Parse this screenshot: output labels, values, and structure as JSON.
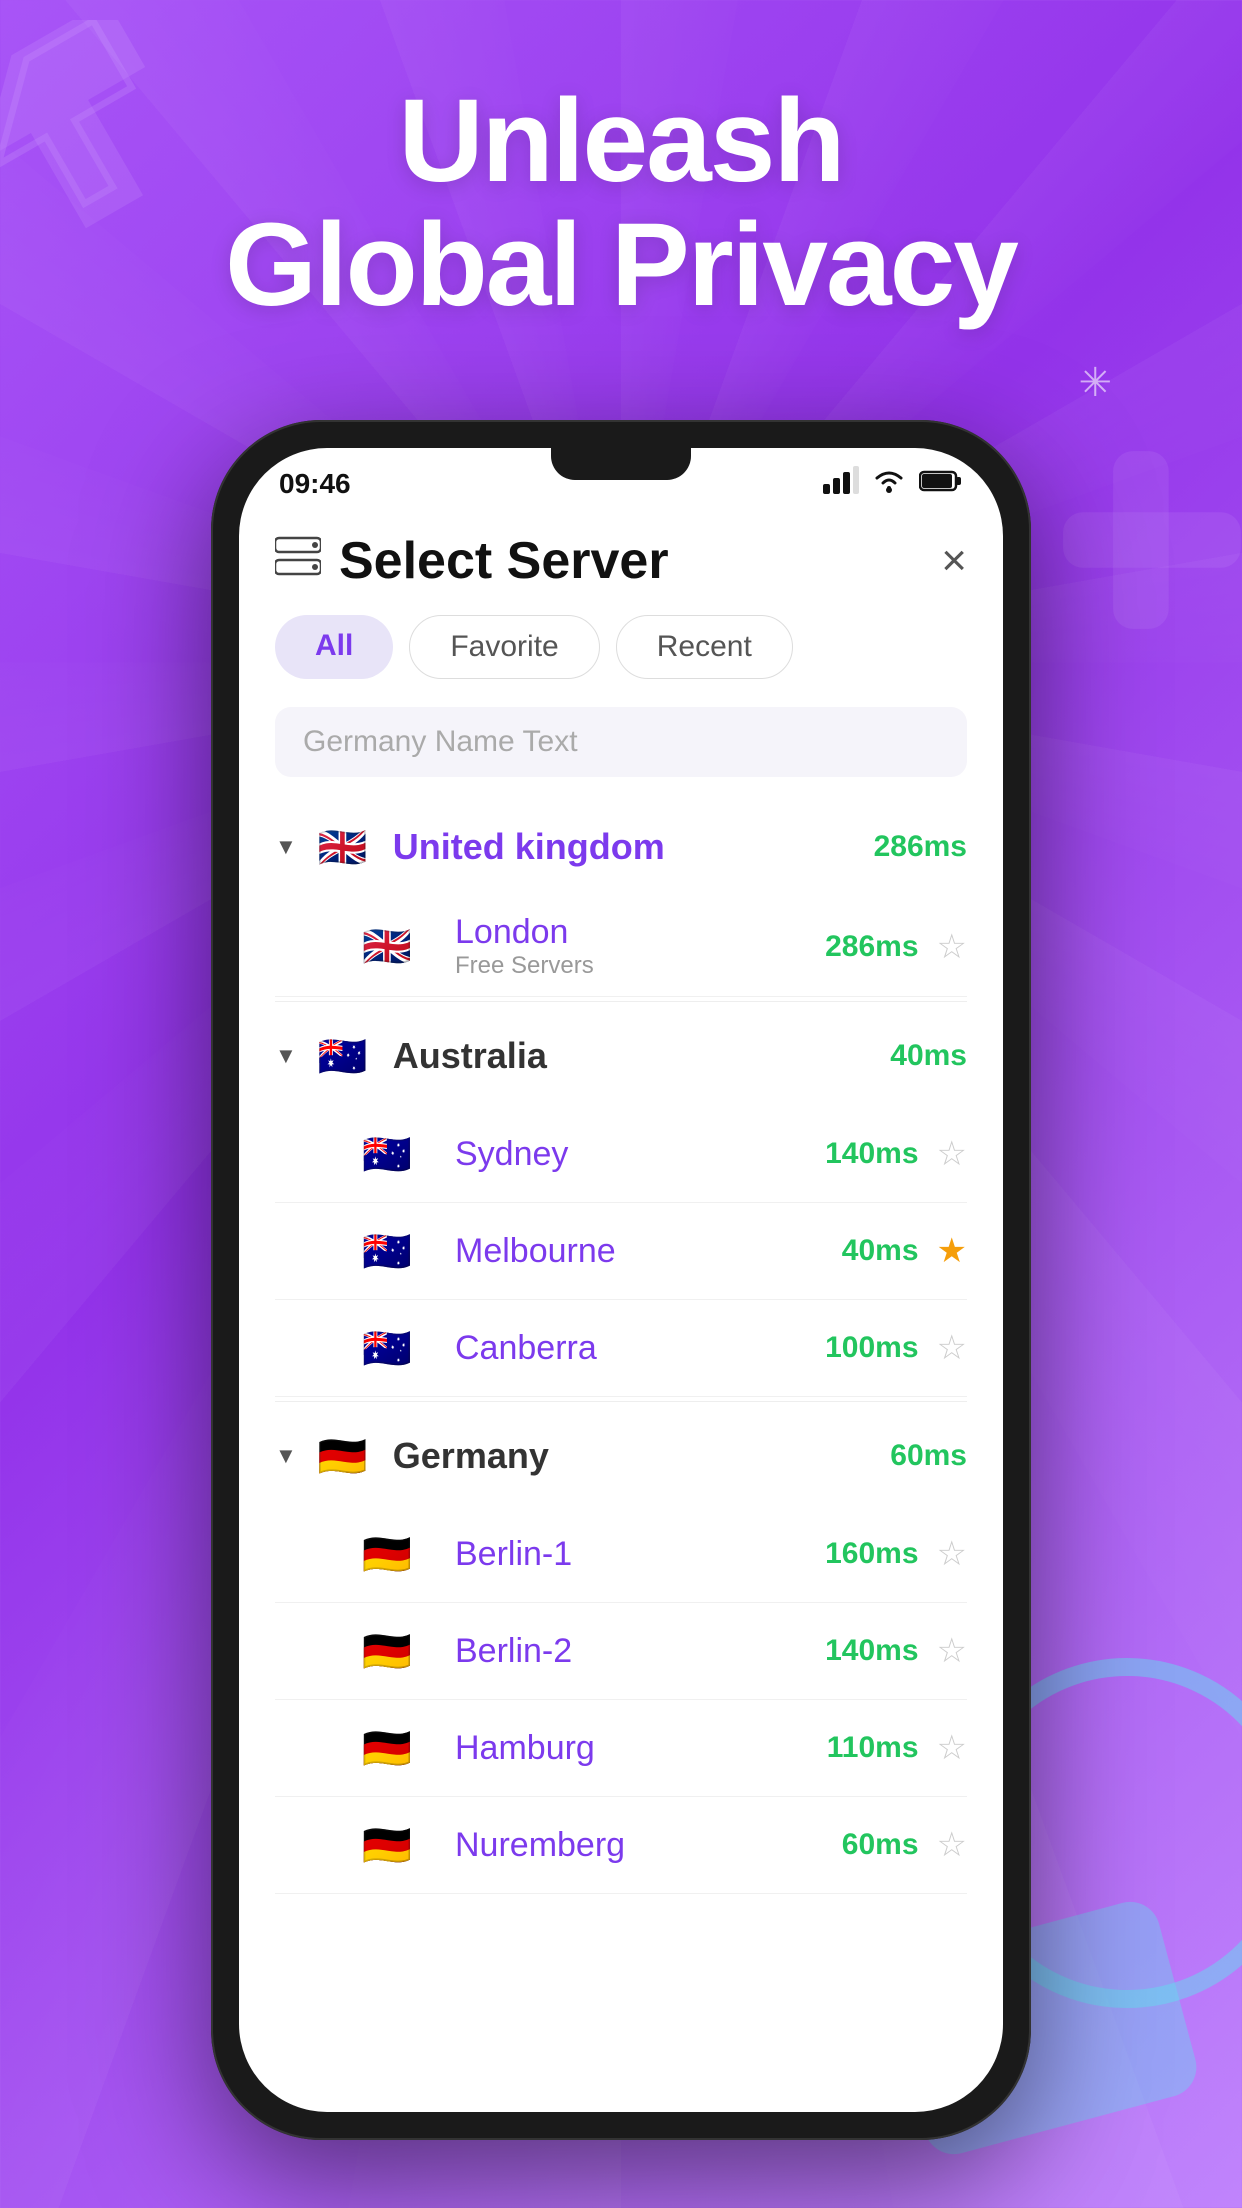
{
  "background": {
    "gradient_start": "#a855f7",
    "gradient_end": "#9333ea"
  },
  "headline": {
    "line1": "Unleash",
    "line2": "Global Privacy"
  },
  "phone": {
    "status_bar": {
      "time": "09:46",
      "signal": "signal",
      "wifi": "wifi",
      "battery": "battery"
    },
    "header": {
      "icon": "server-icon",
      "title": "Select Server",
      "close": "×"
    },
    "tabs": [
      {
        "label": "All",
        "active": true
      },
      {
        "label": "Favorite",
        "active": false
      },
      {
        "label": "Recent",
        "active": false
      }
    ],
    "search": {
      "placeholder": "Germany Name Text"
    },
    "countries": [
      {
        "name": "United kingdom",
        "flag": "🇬🇧",
        "latency": "286ms",
        "expanded": true,
        "servers": [
          {
            "name": "London",
            "sub": "Free Servers",
            "latency": "286ms",
            "favorite": false
          }
        ]
      },
      {
        "name": "Australia",
        "flag": "🇦🇺",
        "latency": "40ms",
        "expanded": true,
        "servers": [
          {
            "name": "Sydney",
            "sub": "",
            "latency": "140ms",
            "favorite": false
          },
          {
            "name": "Melbourne",
            "sub": "",
            "latency": "40ms",
            "favorite": true
          },
          {
            "name": "Canberra",
            "sub": "",
            "latency": "100ms",
            "favorite": false
          }
        ]
      },
      {
        "name": "Germany",
        "flag": "🇩🇪",
        "latency": "60ms",
        "expanded": true,
        "servers": [
          {
            "name": "Berlin-1",
            "sub": "",
            "latency": "160ms",
            "favorite": false
          },
          {
            "name": "Berlin-2",
            "sub": "",
            "latency": "140ms",
            "favorite": false
          },
          {
            "name": "Hamburg",
            "sub": "",
            "latency": "110ms",
            "favorite": false
          },
          {
            "name": "Nuremberg",
            "sub": "",
            "latency": "60ms",
            "favorite": false
          }
        ]
      }
    ]
  }
}
